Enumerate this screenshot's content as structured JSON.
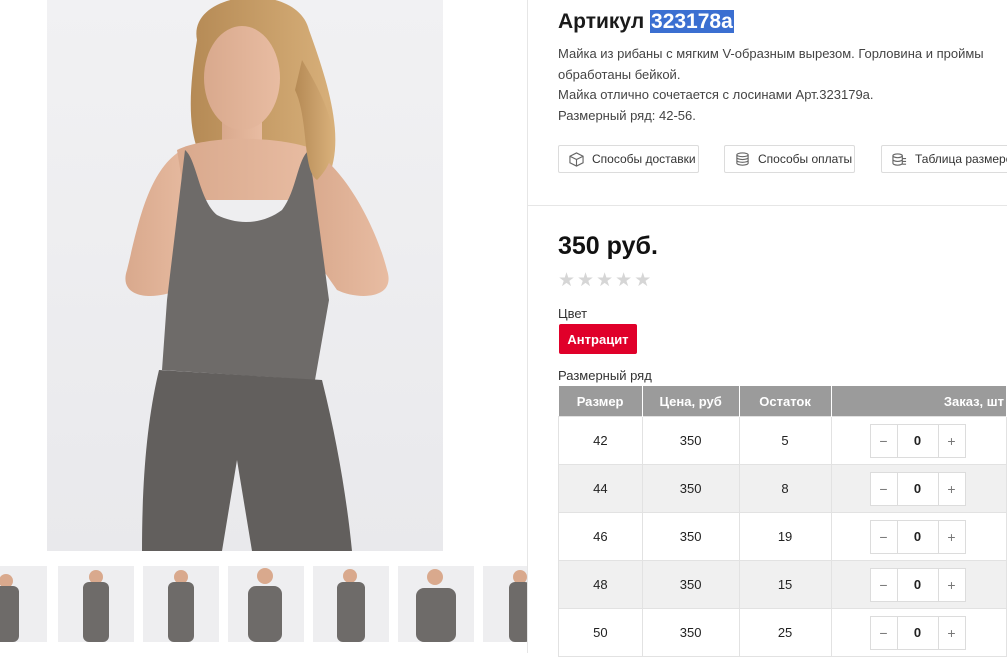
{
  "product": {
    "title_prefix": "Артикул",
    "sku": "323178а",
    "description": [
      "Майка из рибаны с мягким V-образным вырезом. Горловина и проймы",
      "обработаны бейкой.",
      "Майка отлично сочетается с лосинами Арт.323179а.",
      "Размерный ряд: 42-56."
    ],
    "price": "350 руб.",
    "rating": 0,
    "stars": [
      "★",
      "★",
      "★",
      "★",
      "★"
    ]
  },
  "info_buttons": [
    {
      "label": "Способы доставки",
      "icon": "box-icon"
    },
    {
      "label": "Способы оплаты",
      "icon": "coins-icon"
    },
    {
      "label": "Таблица размеров",
      "icon": "size-table-icon"
    }
  ],
  "color": {
    "label": "Цвет",
    "selected": "Антрацит",
    "accent": "#e0002a"
  },
  "sizes": {
    "label": "Размерный ряд",
    "headers": [
      "Размер",
      "Цена, руб",
      "Остаток",
      "Заказ, шт"
    ],
    "rows": [
      {
        "size": "42",
        "price": "350",
        "stock": "5",
        "qty": "0"
      },
      {
        "size": "44",
        "price": "350",
        "stock": "8",
        "qty": "0"
      },
      {
        "size": "46",
        "price": "350",
        "stock": "19",
        "qty": "0"
      },
      {
        "size": "48",
        "price": "350",
        "stock": "15",
        "qty": "0"
      },
      {
        "size": "50",
        "price": "350",
        "stock": "25",
        "qty": "0"
      }
    ],
    "minus": "−",
    "plus": "+"
  },
  "colors": {
    "selection": "#3b6fd1",
    "table_header": "#9b9b9b",
    "garment": "#6e6b69"
  }
}
